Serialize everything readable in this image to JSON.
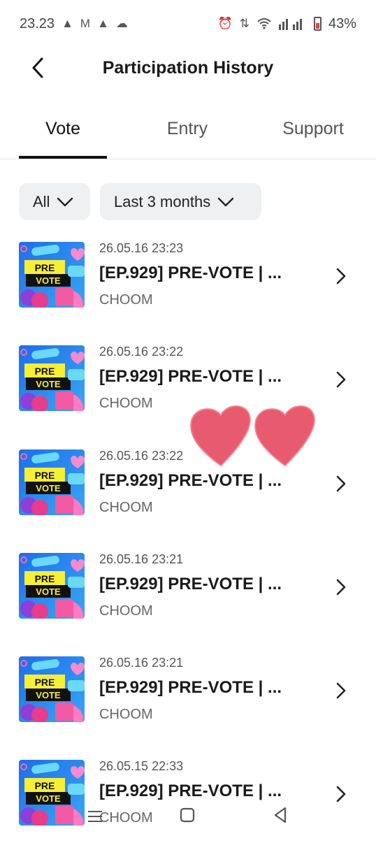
{
  "status_bar": {
    "time": "23.23",
    "battery": "43%"
  },
  "header": {
    "title": "Participation History"
  },
  "tabs": [
    {
      "label": "Vote",
      "active": true
    },
    {
      "label": "Entry",
      "active": false
    },
    {
      "label": "Support",
      "active": false
    }
  ],
  "filters": {
    "type": "All",
    "period": "Last 3 months"
  },
  "thumbnail": {
    "line1": "PRE",
    "line2": "VOTE"
  },
  "items": [
    {
      "date": "26.05.16 23:23",
      "title": "[EP.929] PRE-VOTE | ...",
      "artist": "CHOOM"
    },
    {
      "date": "26.05.16 23:22",
      "title": "[EP.929] PRE-VOTE | ...",
      "artist": "CHOOM"
    },
    {
      "date": "26.05.16 23:22",
      "title": "[EP.929] PRE-VOTE | ...",
      "artist": "CHOOM"
    },
    {
      "date": "26.05.16 23:21",
      "title": "[EP.929] PRE-VOTE | ...",
      "artist": "CHOOM"
    },
    {
      "date": "26.05.16 23:21",
      "title": "[EP.929] PRE-VOTE | ...",
      "artist": "CHOOM"
    },
    {
      "date": "26.05.15 22:33",
      "title": "[EP.929] PRE-VOTE | ...",
      "artist": "CHOOM"
    }
  ],
  "colors": {
    "accent": "#111111",
    "chip_bg": "#eff0f2",
    "heart": "#e85a6d",
    "thumb_yellow": "#f7ee36",
    "thumb_blue": "#2f7cf0"
  },
  "icons": {
    "back": "chevron-left-icon",
    "chevron": "chevron-right-icon",
    "dropdown": "chevron-down-icon"
  }
}
